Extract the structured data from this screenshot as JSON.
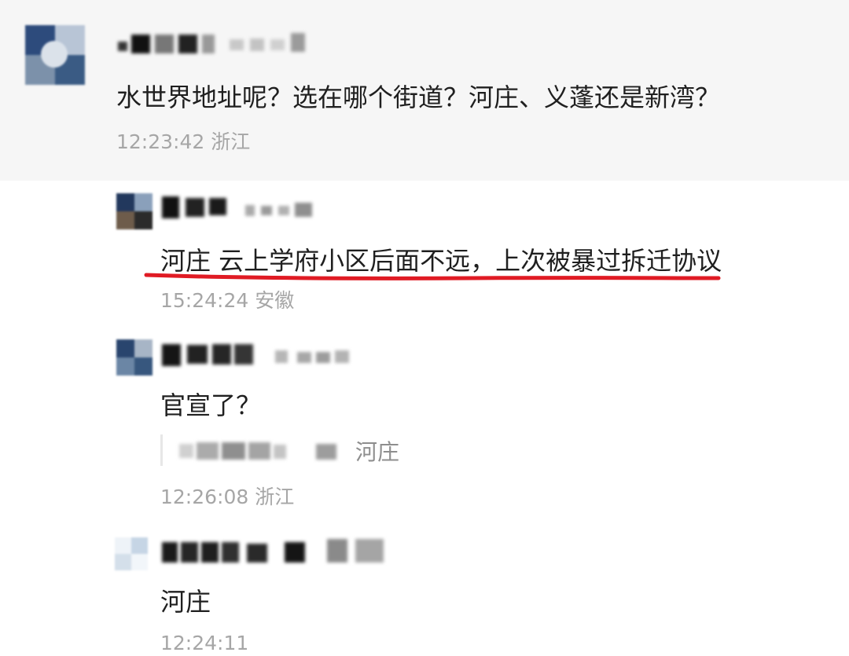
{
  "comments": [
    {
      "text": "水世界地址呢？选在哪个街道？河庄、义蓬还是新湾？",
      "time": "12:23:42",
      "location": "浙江",
      "avatar_icon": "blurred-avatar-icon"
    },
    {
      "text": "河庄 云上学府小区后面不远，上次被暴过拆迁协议",
      "time": "15:24:24",
      "location": "安徽",
      "avatar_icon": "blurred-avatar-icon",
      "highlighted": true
    },
    {
      "text": "官宣了？",
      "quote_text": "河庄",
      "time": "12:26:08",
      "location": "浙江",
      "avatar_icon": "blurred-avatar-icon"
    },
    {
      "text": "河庄",
      "time": "12:24:11",
      "location": "",
      "avatar_icon": "blurred-avatar-icon"
    }
  ],
  "colors": {
    "highlight_underline": "#e01b24",
    "top_comment_background": "#f6f6f6",
    "meta_text": "#a6a6a6"
  }
}
